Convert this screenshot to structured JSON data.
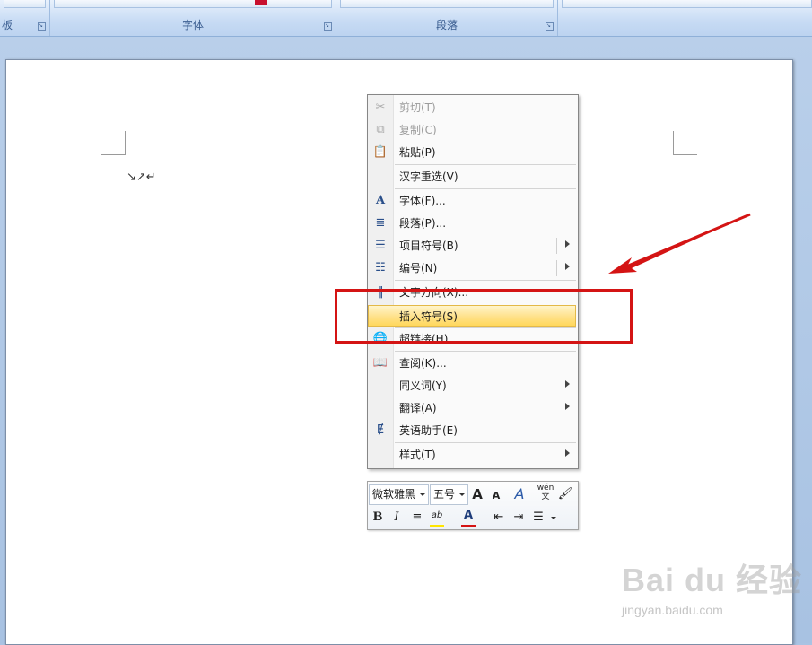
{
  "ribbon": {
    "groups": [
      {
        "label": "板",
        "launcher": "↘"
      },
      {
        "label": "字体",
        "launcher": "↘"
      },
      {
        "label": "段落",
        "launcher": "↘"
      },
      {
        "label": "",
        "launcher": ""
      }
    ]
  },
  "document": {
    "paragraph_marks": "↘↗↵"
  },
  "context_menu": {
    "items": [
      {
        "icon": "✂",
        "label": "剪切(T)",
        "disabled": true
      },
      {
        "icon": "⧉",
        "label": "复制(C)",
        "disabled": true
      },
      {
        "icon": "📋",
        "label": "粘贴(P)"
      },
      {
        "icon": "",
        "label": "汉字重选(V)"
      },
      {
        "icon": "A",
        "label": "字体(F)..."
      },
      {
        "icon": "≣",
        "label": "段落(P)..."
      },
      {
        "icon": "☰",
        "label": "项目符号(B)",
        "submenu": true,
        "split": true
      },
      {
        "icon": "☷",
        "label": "编号(N)",
        "submenu": true,
        "split": true
      },
      {
        "icon": "‖",
        "label": "文字方向(X)..."
      },
      {
        "icon": "",
        "label": "插入符号(S)",
        "highlighted": true
      },
      {
        "icon": "🌐",
        "label": "超链接(H)..."
      },
      {
        "icon": "📖",
        "label": "查阅(K)..."
      },
      {
        "icon": "",
        "label": "同义词(Y)",
        "submenu": true
      },
      {
        "icon": "",
        "label": "翻译(A)",
        "submenu": true
      },
      {
        "icon": "Ɇ",
        "label": "英语助手(E)"
      },
      {
        "icon": "",
        "label": "样式(T)",
        "submenu": true
      }
    ]
  },
  "mini_toolbar": {
    "font_name": "微软雅黑",
    "font_size": "五号",
    "grow_font": "A",
    "shrink_font": "A",
    "styles": "A",
    "phonetic": "wén 文",
    "format_painter": "🖌",
    "bold": "B",
    "italic": "I",
    "center": "≡",
    "highlight": "ab",
    "font_color": "A",
    "decrease_indent": "⇤",
    "increase_indent": "⇥",
    "bullets": "☰"
  },
  "watermark": {
    "logo": "Bai du 经验",
    "url": "jingyan.baidu.com"
  },
  "colors": {
    "annotation": "#d41414",
    "menu_highlight": "#ffe18a",
    "font_color_bar": "#d41414",
    "highlight_bar": "#ffe600"
  }
}
